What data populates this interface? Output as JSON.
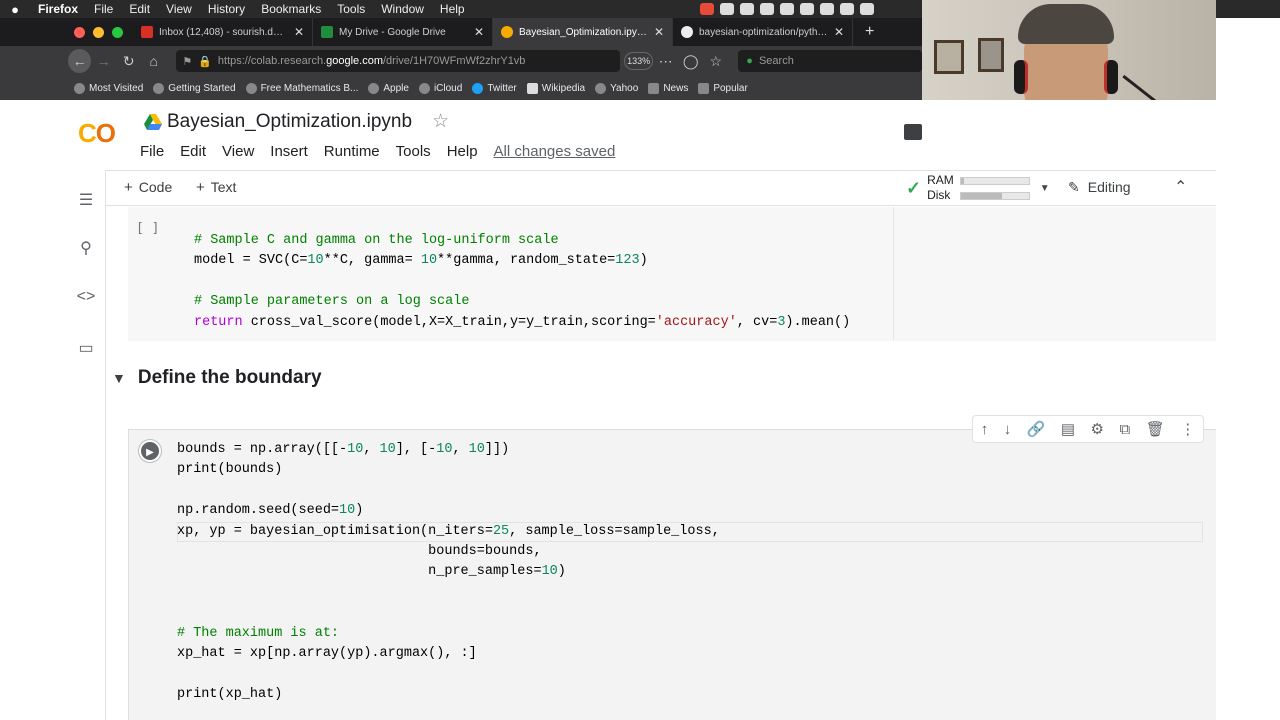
{
  "menubar": {
    "app": "Firefox",
    "items": [
      "File",
      "Edit",
      "View",
      "History",
      "Bookmarks",
      "Tools",
      "Window",
      "Help"
    ]
  },
  "tabs": [
    {
      "label": "Inbox (12,408) - sourish.das@g",
      "color": "#d93025"
    },
    {
      "label": "My Drive - Google Drive",
      "color": "#1e8e3e"
    },
    {
      "label": "Bayesian_Optimization.ipynb - C",
      "color": "#f9ab00"
    },
    {
      "label": "bayesian-optimization/python a",
      "color": "#eeeeee"
    }
  ],
  "nav": {
    "url_prefix": "https://colab.research.",
    "url_domain": "google.com",
    "url_rest": "/drive/1H70WFmWf2zhrY1vb",
    "zoom": "133%",
    "search_placeholder": "Search"
  },
  "bookmarks": [
    "Most Visited",
    "Getting Started",
    "Free Mathematics B...",
    "Apple",
    "iCloud",
    "Twitter",
    "Wikipedia",
    "Yahoo",
    "News",
    "Popular"
  ],
  "colab": {
    "logo": "CO",
    "title": "Bayesian_Optimization.ipynb",
    "menu": [
      "File",
      "Edit",
      "View",
      "Insert",
      "Runtime",
      "Tools",
      "Help"
    ],
    "saved": "All changes saved",
    "toolbar": {
      "code": "Code",
      "text": "Text",
      "ram": "RAM",
      "disk": "Disk",
      "editing": "Editing",
      "ram_level": 0.05,
      "disk_level": 0.6
    }
  },
  "cells": {
    "cell1_prompt": "[ ]",
    "section_title": "Define the boundary"
  },
  "colors": {
    "accent_orange": "#f9ab00",
    "keyword": "#af00db",
    "comment": "#008000",
    "number": "#09885a",
    "string": "#a31515"
  }
}
